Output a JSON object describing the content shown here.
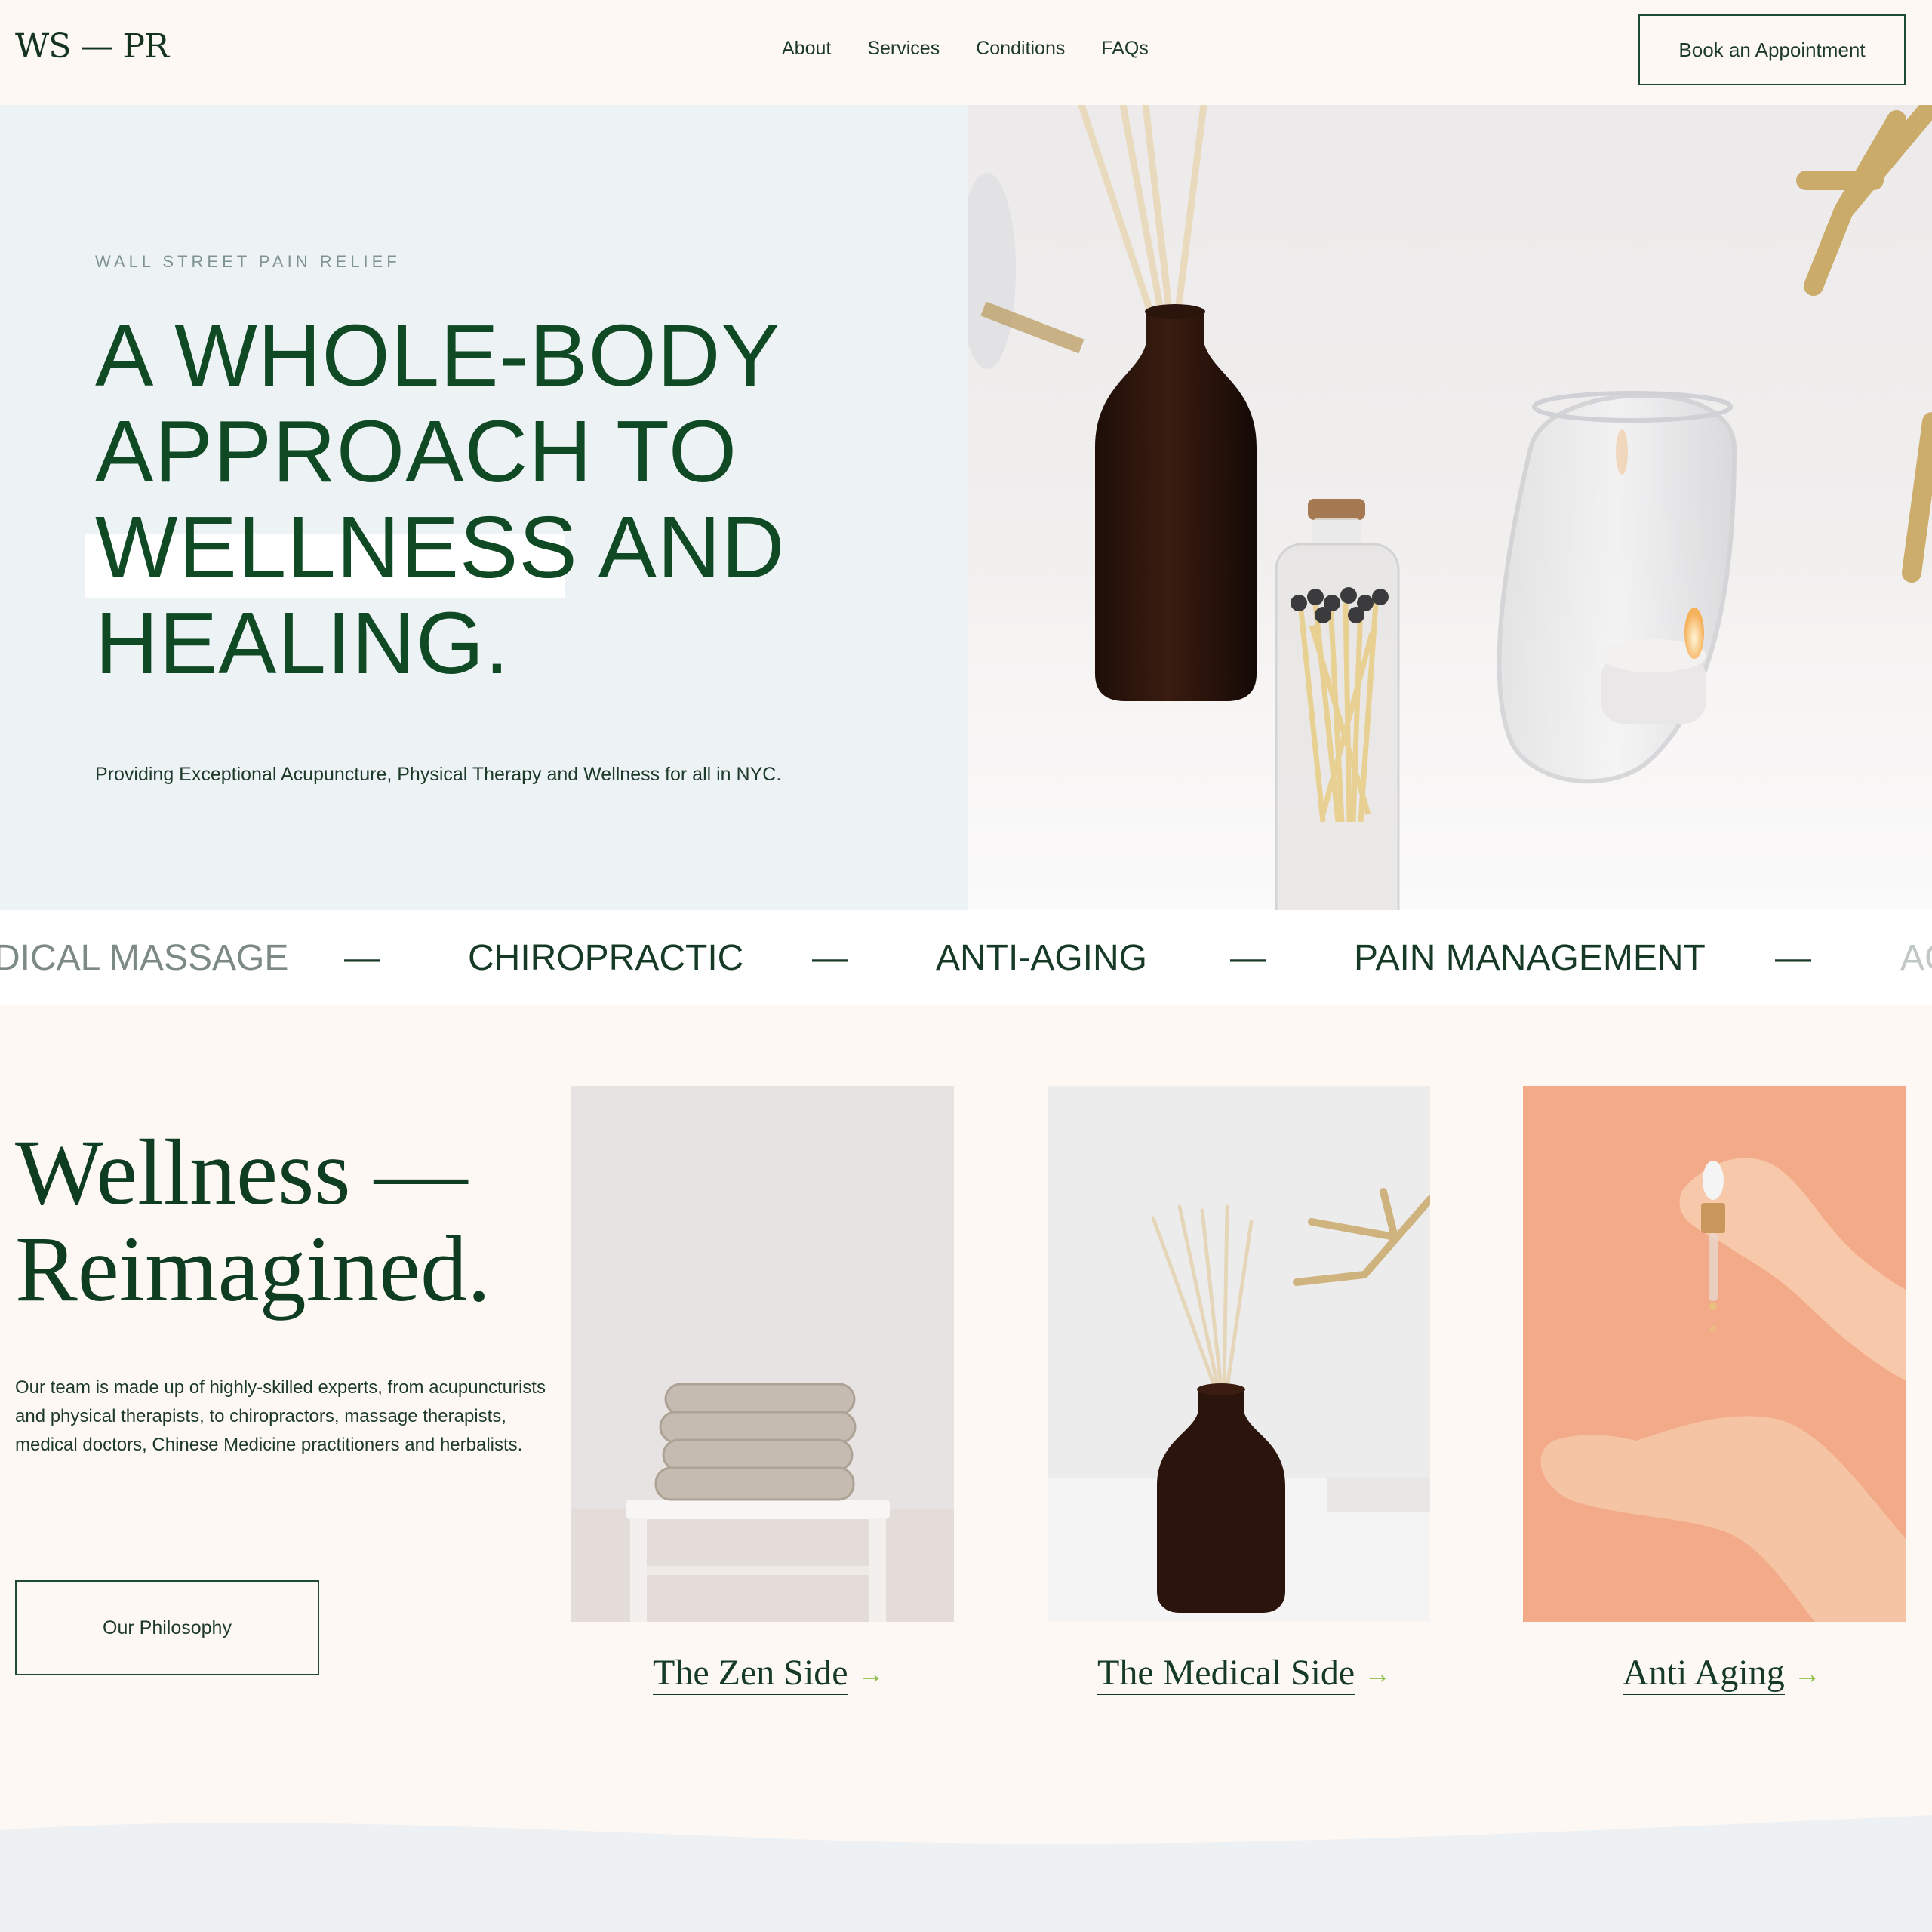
{
  "header": {
    "logo": "WS — PR",
    "nav": [
      "About",
      "Services",
      "Conditions",
      "FAQs"
    ],
    "cta": "Book an Appointment"
  },
  "hero": {
    "eyebrow": "WALL STREET PAIN RELIEF",
    "title_lines": [
      "A WHOLE-BODY",
      "APPROACH TO",
      "WELLNESS AND",
      "HEALING."
    ],
    "subtitle": "Providing Exceptional Acupuncture, Physical Therapy and Wellness for all in NYC."
  },
  "ticker": {
    "items": [
      "DICAL MASSAGE",
      "CHIROPRACTIC",
      "ANTI-AGING",
      "PAIN MANAGEMENT",
      "AC"
    ],
    "separator": "—"
  },
  "wellness": {
    "title_line1": "Wellness —",
    "title_line2": "Reimagined.",
    "body_lines": [
      "Our team is made up of highly-skilled experts, from acupuncturists",
      "and physical therapists, to chiropractors, massage therapists,",
      "medical doctors,  Chinese Medicine practitioners and herbalists."
    ],
    "button": "Our Philosophy"
  },
  "cards": [
    {
      "label": "The Zen Side",
      "arrow": "→"
    },
    {
      "label": "The Medical Side",
      "arrow": "→"
    },
    {
      "label": "Anti Aging",
      "arrow": "→"
    }
  ],
  "colors": {
    "brand_green": "#0f4a24",
    "accent_arrow": "#8cc24a",
    "cream_bg": "#fdf8f3",
    "hero_bg": "#edf2f5",
    "anti_aging_bg": "#f3a885"
  }
}
